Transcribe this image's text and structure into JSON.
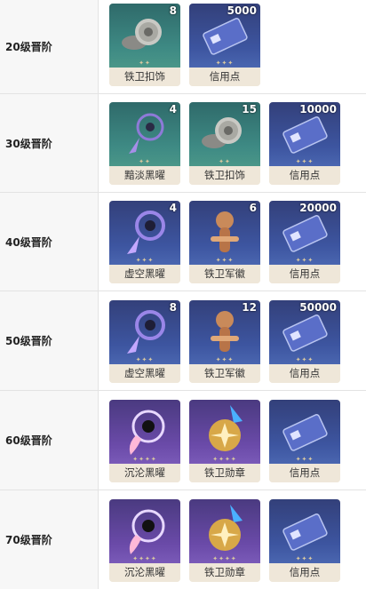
{
  "rows": [
    {
      "level": "20级晋阶",
      "items": [
        {
          "name": "铁卫扣饰",
          "count": "8",
          "icon": "iron-buckle-icon"
        },
        {
          "name": "信用点",
          "count": "5000",
          "icon": "credit-card-icon"
        }
      ]
    },
    {
      "level": "30级晋阶",
      "items": [
        {
          "name": "黯淡黑曜",
          "count": "4",
          "icon": "dim-obsidian-icon"
        },
        {
          "name": "铁卫扣饰",
          "count": "15",
          "icon": "iron-buckle-icon"
        },
        {
          "name": "信用点",
          "count": "10000",
          "icon": "credit-card-icon"
        }
      ]
    },
    {
      "level": "40级晋阶",
      "items": [
        {
          "name": "虚空黑曜",
          "count": "4",
          "icon": "void-obsidian-icon"
        },
        {
          "name": "铁卫军徽",
          "count": "6",
          "icon": "iron-insignia-icon"
        },
        {
          "name": "信用点",
          "count": "20000",
          "icon": "credit-card-icon"
        }
      ]
    },
    {
      "level": "50级晋阶",
      "items": [
        {
          "name": "虚空黑曜",
          "count": "8",
          "icon": "void-obsidian-icon"
        },
        {
          "name": "铁卫军徽",
          "count": "12",
          "icon": "iron-insignia-icon"
        },
        {
          "name": "信用点",
          "count": "50000",
          "icon": "credit-card-icon"
        }
      ]
    },
    {
      "level": "60级晋阶",
      "items": [
        {
          "name": "沉沦黑曜",
          "count": "",
          "icon": "abyss-obsidian-icon"
        },
        {
          "name": "铁卫勋章",
          "count": "",
          "icon": "iron-medal-icon"
        },
        {
          "name": "信用点",
          "count": "",
          "icon": "credit-card-icon"
        }
      ]
    },
    {
      "level": "70级晋阶",
      "items": [
        {
          "name": "沉沦黑曜",
          "count": "",
          "icon": "abyss-obsidian-icon"
        },
        {
          "name": "铁卫勋章",
          "count": "",
          "icon": "iron-medal-icon"
        },
        {
          "name": "信用点",
          "count": "",
          "icon": "credit-card-icon"
        }
      ]
    }
  ]
}
